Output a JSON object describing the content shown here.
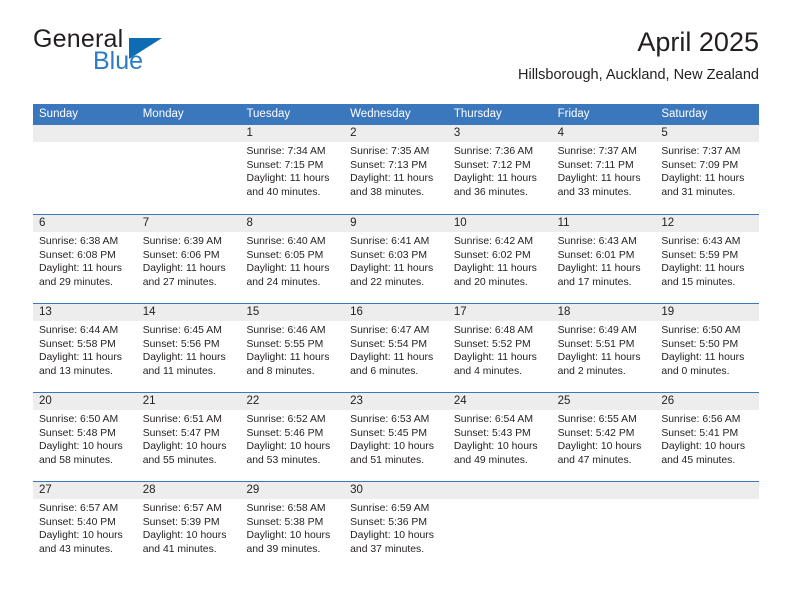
{
  "logo": {
    "word_top": "General",
    "word_bottom": "Blue",
    "icon": "triangle-mark"
  },
  "header": {
    "title": "April 2025",
    "subtitle": "Hillsborough, Auckland, New Zealand"
  },
  "colors": {
    "header_blue": "#3b77bd",
    "logo_blue": "#2b7cc3",
    "day_band_gray": "#ededed",
    "text": "#231f20"
  },
  "calendar": {
    "weekday_headers": [
      "Sunday",
      "Monday",
      "Tuesday",
      "Wednesday",
      "Thursday",
      "Friday",
      "Saturday"
    ],
    "weeks": [
      [
        {
          "day": "",
          "empty": true
        },
        {
          "day": "",
          "empty": true
        },
        {
          "day": "1",
          "sunrise": "Sunrise: 7:34 AM",
          "sunset": "Sunset: 7:15 PM",
          "daylight": "Daylight: 11 hours and 40 minutes."
        },
        {
          "day": "2",
          "sunrise": "Sunrise: 7:35 AM",
          "sunset": "Sunset: 7:13 PM",
          "daylight": "Daylight: 11 hours and 38 minutes."
        },
        {
          "day": "3",
          "sunrise": "Sunrise: 7:36 AM",
          "sunset": "Sunset: 7:12 PM",
          "daylight": "Daylight: 11 hours and 36 minutes."
        },
        {
          "day": "4",
          "sunrise": "Sunrise: 7:37 AM",
          "sunset": "Sunset: 7:11 PM",
          "daylight": "Daylight: 11 hours and 33 minutes."
        },
        {
          "day": "5",
          "sunrise": "Sunrise: 7:37 AM",
          "sunset": "Sunset: 7:09 PM",
          "daylight": "Daylight: 11 hours and 31 minutes."
        }
      ],
      [
        {
          "day": "6",
          "sunrise": "Sunrise: 6:38 AM",
          "sunset": "Sunset: 6:08 PM",
          "daylight": "Daylight: 11 hours and 29 minutes."
        },
        {
          "day": "7",
          "sunrise": "Sunrise: 6:39 AM",
          "sunset": "Sunset: 6:06 PM",
          "daylight": "Daylight: 11 hours and 27 minutes."
        },
        {
          "day": "8",
          "sunrise": "Sunrise: 6:40 AM",
          "sunset": "Sunset: 6:05 PM",
          "daylight": "Daylight: 11 hours and 24 minutes."
        },
        {
          "day": "9",
          "sunrise": "Sunrise: 6:41 AM",
          "sunset": "Sunset: 6:03 PM",
          "daylight": "Daylight: 11 hours and 22 minutes."
        },
        {
          "day": "10",
          "sunrise": "Sunrise: 6:42 AM",
          "sunset": "Sunset: 6:02 PM",
          "daylight": "Daylight: 11 hours and 20 minutes."
        },
        {
          "day": "11",
          "sunrise": "Sunrise: 6:43 AM",
          "sunset": "Sunset: 6:01 PM",
          "daylight": "Daylight: 11 hours and 17 minutes."
        },
        {
          "day": "12",
          "sunrise": "Sunrise: 6:43 AM",
          "sunset": "Sunset: 5:59 PM",
          "daylight": "Daylight: 11 hours and 15 minutes."
        }
      ],
      [
        {
          "day": "13",
          "sunrise": "Sunrise: 6:44 AM",
          "sunset": "Sunset: 5:58 PM",
          "daylight": "Daylight: 11 hours and 13 minutes."
        },
        {
          "day": "14",
          "sunrise": "Sunrise: 6:45 AM",
          "sunset": "Sunset: 5:56 PM",
          "daylight": "Daylight: 11 hours and 11 minutes."
        },
        {
          "day": "15",
          "sunrise": "Sunrise: 6:46 AM",
          "sunset": "Sunset: 5:55 PM",
          "daylight": "Daylight: 11 hours and 8 minutes."
        },
        {
          "day": "16",
          "sunrise": "Sunrise: 6:47 AM",
          "sunset": "Sunset: 5:54 PM",
          "daylight": "Daylight: 11 hours and 6 minutes."
        },
        {
          "day": "17",
          "sunrise": "Sunrise: 6:48 AM",
          "sunset": "Sunset: 5:52 PM",
          "daylight": "Daylight: 11 hours and 4 minutes."
        },
        {
          "day": "18",
          "sunrise": "Sunrise: 6:49 AM",
          "sunset": "Sunset: 5:51 PM",
          "daylight": "Daylight: 11 hours and 2 minutes."
        },
        {
          "day": "19",
          "sunrise": "Sunrise: 6:50 AM",
          "sunset": "Sunset: 5:50 PM",
          "daylight": "Daylight: 11 hours and 0 minutes."
        }
      ],
      [
        {
          "day": "20",
          "sunrise": "Sunrise: 6:50 AM",
          "sunset": "Sunset: 5:48 PM",
          "daylight": "Daylight: 10 hours and 58 minutes."
        },
        {
          "day": "21",
          "sunrise": "Sunrise: 6:51 AM",
          "sunset": "Sunset: 5:47 PM",
          "daylight": "Daylight: 10 hours and 55 minutes."
        },
        {
          "day": "22",
          "sunrise": "Sunrise: 6:52 AM",
          "sunset": "Sunset: 5:46 PM",
          "daylight": "Daylight: 10 hours and 53 minutes."
        },
        {
          "day": "23",
          "sunrise": "Sunrise: 6:53 AM",
          "sunset": "Sunset: 5:45 PM",
          "daylight": "Daylight: 10 hours and 51 minutes."
        },
        {
          "day": "24",
          "sunrise": "Sunrise: 6:54 AM",
          "sunset": "Sunset: 5:43 PM",
          "daylight": "Daylight: 10 hours and 49 minutes."
        },
        {
          "day": "25",
          "sunrise": "Sunrise: 6:55 AM",
          "sunset": "Sunset: 5:42 PM",
          "daylight": "Daylight: 10 hours and 47 minutes."
        },
        {
          "day": "26",
          "sunrise": "Sunrise: 6:56 AM",
          "sunset": "Sunset: 5:41 PM",
          "daylight": "Daylight: 10 hours and 45 minutes."
        }
      ],
      [
        {
          "day": "27",
          "sunrise": "Sunrise: 6:57 AM",
          "sunset": "Sunset: 5:40 PM",
          "daylight": "Daylight: 10 hours and 43 minutes."
        },
        {
          "day": "28",
          "sunrise": "Sunrise: 6:57 AM",
          "sunset": "Sunset: 5:39 PM",
          "daylight": "Daylight: 10 hours and 41 minutes."
        },
        {
          "day": "29",
          "sunrise": "Sunrise: 6:58 AM",
          "sunset": "Sunset: 5:38 PM",
          "daylight": "Daylight: 10 hours and 39 minutes."
        },
        {
          "day": "30",
          "sunrise": "Sunrise: 6:59 AM",
          "sunset": "Sunset: 5:36 PM",
          "daylight": "Daylight: 10 hours and 37 minutes."
        },
        {
          "day": "",
          "empty": true
        },
        {
          "day": "",
          "empty": true
        },
        {
          "day": "",
          "empty": true
        }
      ]
    ]
  }
}
